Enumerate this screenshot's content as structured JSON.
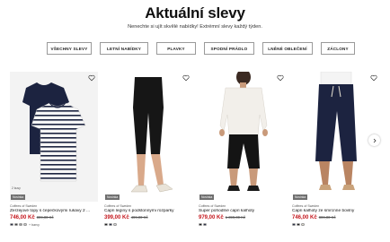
{
  "header": {
    "title": "Aktuální slevy",
    "subtitle": "Nenechte si ujít skvělé nabídky! Extrémní slevy každý týden."
  },
  "filters": [
    {
      "label": "VŠECHNY SLEVY"
    },
    {
      "label": "LETNÍ NABÍDKY"
    },
    {
      "label": "PLAVKY"
    },
    {
      "label": "SPODNÍ PRÁDLO"
    },
    {
      "label": "LNĚNÉ OBLEČENÍ"
    },
    {
      "label": "ZÁCLONY"
    }
  ],
  "products": [
    {
      "badge": "Novinka",
      "brand": "Coffees of Sweden",
      "name": "Žerzejové topy s čepečkovými rukávy 2 ...",
      "price": "746,00 Kč",
      "old_price": "899,00 Kč",
      "photo_badge": "2 kusy",
      "swatches": [
        "#1c2340",
        "#3a3a3a",
        "#9a9a9a",
        "#c9c9c9"
      ],
      "swatch_more": "+ barvy"
    },
    {
      "badge": "Novinka",
      "brand": "Coffees of Sweden",
      "name": "Capri legíny s podstonnými rozparky",
      "price": "399,00 Kč",
      "old_price": "499,00 Kč",
      "swatches": [
        "#111111",
        "#1c2340",
        "#dddddd"
      ]
    },
    {
      "badge": "Novinka",
      "brand": "Coffees of Sweden",
      "name": "Super pohodlné capri kalhoty",
      "price": "979,00 Kč",
      "old_price": "1 399,00 Kč",
      "swatches": [
        "#111111",
        "#1c2340"
      ]
    },
    {
      "badge": "Novinka",
      "brand": "Coffees of Sweden",
      "name": "Capri kalhoty ze smrcnne bovlny",
      "price": "746,00 Kč",
      "old_price": "899,00 Kč",
      "swatches": [
        "#1c2340",
        "#111111",
        "#e6e0d2"
      ]
    }
  ],
  "colors": {
    "price_red": "#c4161c",
    "navy": "#1c2340",
    "skin": "#d9a98a"
  },
  "icons": {
    "wishlist": "heart-outline-icon",
    "next": "chevron-right-icon"
  }
}
